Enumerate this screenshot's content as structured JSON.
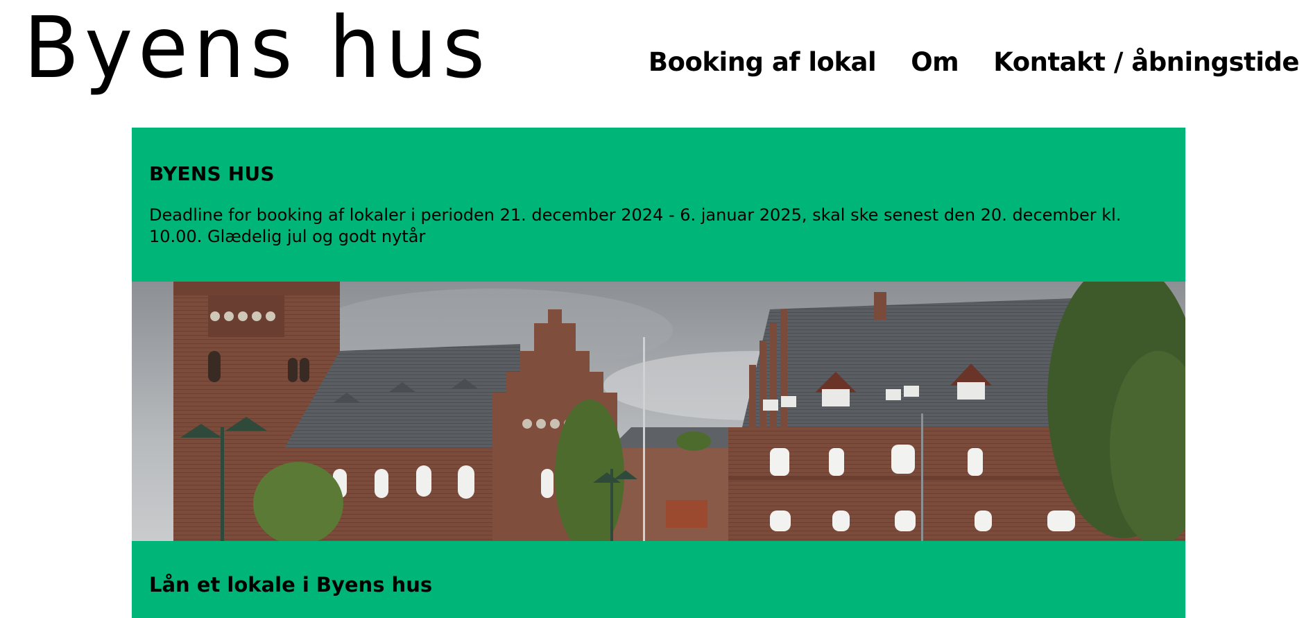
{
  "logo": {
    "text": "Byens hus"
  },
  "nav": {
    "items": [
      {
        "label": "Booking af lokal"
      },
      {
        "label": "Om"
      },
      {
        "label": "Kontakt / åbningstide"
      }
    ]
  },
  "notice": {
    "title": "BYENS HUS",
    "text": "Deadline for booking af lokaler i perioden 21. december 2024 - 6. januar 2025, skal ske senest den 20. december kl. 10.00. Glædelig jul og godt nytår"
  },
  "section": {
    "title": "Lån et lokale i Byens hus"
  },
  "colors": {
    "accent": "#00b578",
    "text": "#000000",
    "brick": "#7a4a3a",
    "roof": "#55595e",
    "sky": "#a9acb0",
    "tree": "#3f5a2a"
  }
}
